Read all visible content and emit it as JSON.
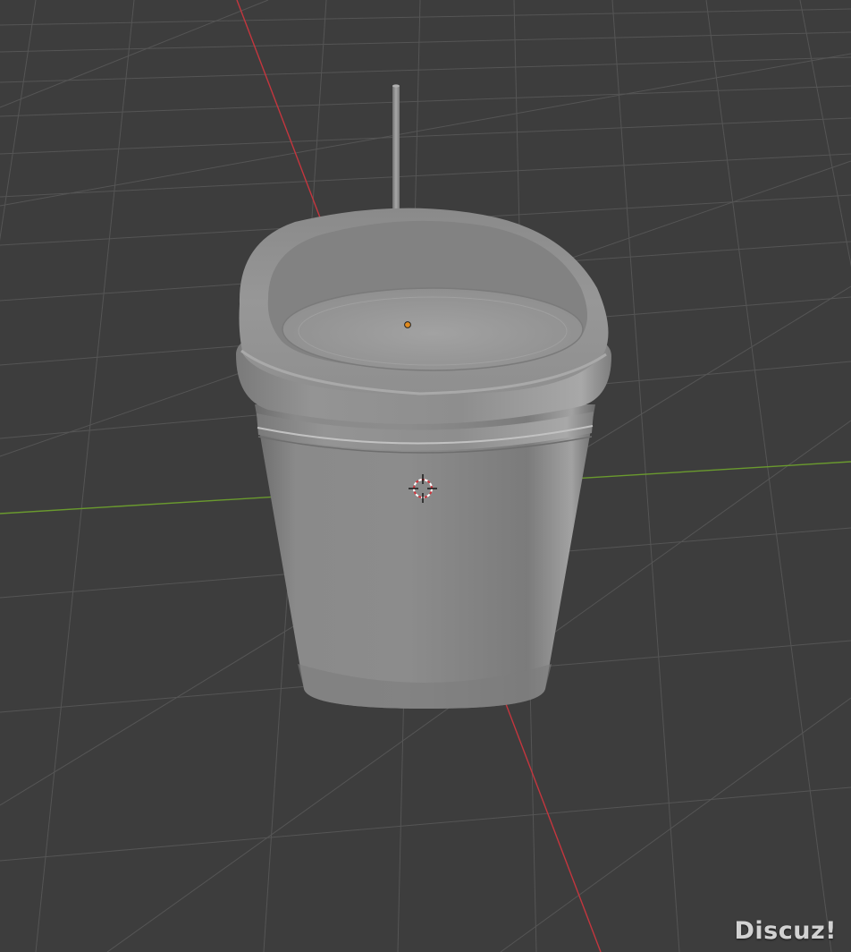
{
  "viewport": {
    "background_color": "#3d3d3d",
    "grid_color": "#555555",
    "x_axis_color": "#c4363e",
    "y_axis_color": "#6a9a2e",
    "model_color": "#8a8a8a"
  },
  "objects": [
    {
      "name": "cup-model",
      "shape": "cup"
    },
    {
      "name": "straw",
      "shape": "cylinder"
    },
    {
      "name": "origin-point",
      "color": "#e08a1e"
    },
    {
      "name": "3d-cursor",
      "icon": "crosshair-icon"
    }
  ],
  "watermark": {
    "text": "Discuz!"
  }
}
